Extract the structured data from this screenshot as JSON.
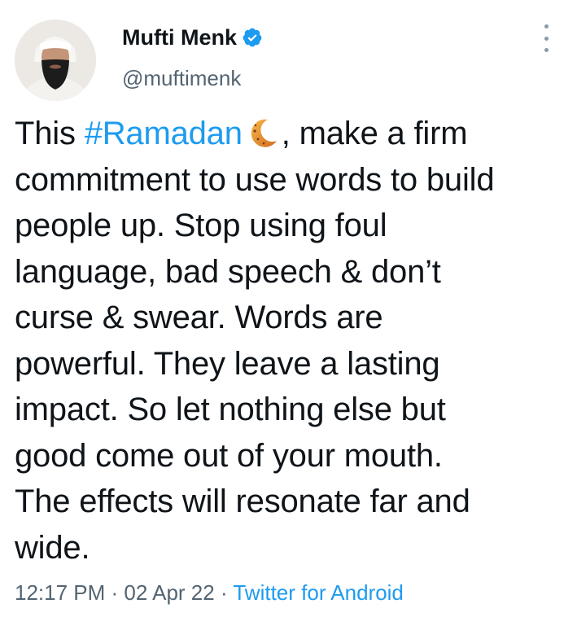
{
  "author": {
    "name": "Mufti Menk",
    "handle": "@muftimenk",
    "verified": true,
    "avatar_icon": "profile-photo"
  },
  "tweet": {
    "lines": [
      {
        "before": "This ",
        "hashtag": "#Ramadan",
        "emoji": "crescent-moon",
        "after": ", make a firm"
      },
      {
        "text": "commitment to use words to build"
      },
      {
        "text": "people up. Stop using foul"
      },
      {
        "text": "language, bad speech & don’t"
      },
      {
        "text": "curse & swear. Words are"
      },
      {
        "text": "powerful. They leave a lasting"
      },
      {
        "text": "impact. So let nothing else but"
      },
      {
        "text": "good come out of your mouth."
      },
      {
        "text": "The effects will resonate far and"
      },
      {
        "text": "wide."
      }
    ]
  },
  "meta": {
    "time": "12:17 PM",
    "separator": " · ",
    "date": "02 Apr 22",
    "source": "Twitter for Android"
  },
  "colors": {
    "link": "#1d9bf0",
    "text": "#0f1419",
    "secondary": "#536471"
  },
  "icons": {
    "verified": "verified-badge-icon",
    "menu": "more-options-icon"
  }
}
